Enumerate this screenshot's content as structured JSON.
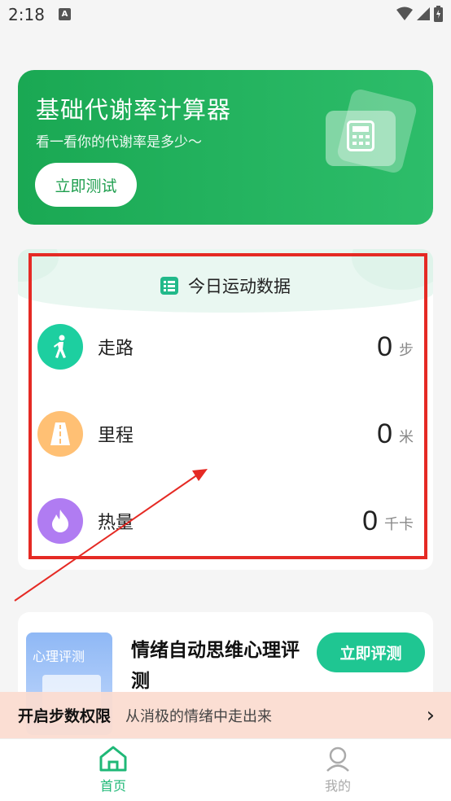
{
  "status_bar": {
    "time": "2:18",
    "notif_letter": "A"
  },
  "banner": {
    "title": "基础代谢率计算器",
    "subtitle": "看一看你的代谢率是多少～",
    "button": "立即测试"
  },
  "sport": {
    "title": "今日运动数据",
    "rows": [
      {
        "label": "走路",
        "value": "0",
        "unit": "步",
        "icon": "walking-icon",
        "color": "#1dcfa0"
      },
      {
        "label": "里程",
        "value": "0",
        "unit": "米",
        "icon": "road-icon",
        "color": "#ffc074"
      },
      {
        "label": "热量",
        "value": "0",
        "unit": "千卡",
        "icon": "flame-icon",
        "color": "#b07cf2"
      }
    ]
  },
  "test": {
    "thumb_label": "心理评测",
    "title": "情绪自动思维心理评测",
    "button": "立即评测"
  },
  "permission": {
    "title": "开启步数权限",
    "desc": "从消极的情绪中走出来"
  },
  "nav": {
    "items": [
      {
        "label": "首页",
        "active": true
      },
      {
        "label": "我的",
        "active": false
      }
    ]
  },
  "colors": {
    "brand_green": "#1aa853",
    "accent_teal": "#1fc692",
    "highlight_red": "#e52a24"
  }
}
